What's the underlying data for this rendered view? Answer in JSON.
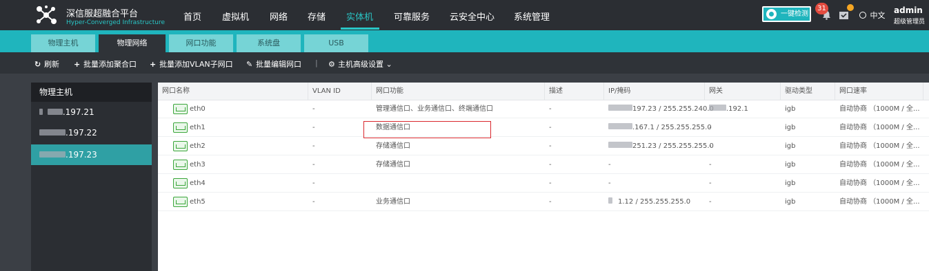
{
  "brand": {
    "title": "深信服超融合平台",
    "subtitle": "Hyper-Converged Infrastructure"
  },
  "nav": [
    "首页",
    "虚拟机",
    "网络",
    "存储",
    "实体机",
    "可靠服务",
    "云安全中心",
    "系统管理"
  ],
  "nav_active": "实体机",
  "header": {
    "onekey_label": "一键检测",
    "alert_count": "31",
    "lang_label": "中文",
    "user_name": "admin",
    "user_role": "超级管理员"
  },
  "tabs": [
    "物理主机",
    "物理网络",
    "网口功能",
    "系统盘",
    "USB"
  ],
  "tab_active": "物理网络",
  "toolbar": {
    "refresh": "刷新",
    "add_agg": "批量添加聚合口",
    "add_vlan": "批量添加VLAN子网口",
    "edit": "批量编辑网口",
    "sep": "|",
    "advanced": "主机高级设置"
  },
  "sidebar": {
    "title": "物理主机",
    "hosts": [
      ".197.21",
      ".197.22",
      ".197.23"
    ],
    "active_index": 2
  },
  "table": {
    "columns": [
      "网口名称",
      "VLAN ID",
      "网口功能",
      "描述",
      "IP/掩码",
      "网关",
      "驱动类型",
      "网口速率"
    ],
    "rows": [
      {
        "name": "eth0",
        "vlan": "-",
        "function": "管理通信口、业务通信口、终端通信口",
        "desc": "-",
        "ip": "197.23 / 255.255.240.0",
        "gateway": ".192.1",
        "driver": "igb",
        "speed": "自动协商 （1000M / 全..."
      },
      {
        "name": "eth1",
        "vlan": "-",
        "function": "数据通信口",
        "desc": "-",
        "ip": ".167.1 / 255.255.255.0",
        "gateway": "-",
        "driver": "igb",
        "speed": "自动协商 （1000M / 全..."
      },
      {
        "name": "eth2",
        "vlan": "-",
        "function": "存储通信口",
        "desc": "-",
        "ip": "251.23 / 255.255.255.0",
        "gateway": "-",
        "driver": "igb",
        "speed": "自动协商 （1000M / 全..."
      },
      {
        "name": "eth3",
        "vlan": "-",
        "function": "存储通信口",
        "desc": "-",
        "ip": "-",
        "gateway": "-",
        "driver": "igb",
        "speed": "自动协商 （1000M / 全..."
      },
      {
        "name": "eth4",
        "vlan": "-",
        "function": "",
        "desc": "-",
        "ip": "-",
        "gateway": "-",
        "driver": "igb",
        "speed": "自动协商 （1000M / 全..."
      },
      {
        "name": "eth5",
        "vlan": "-",
        "function": "业务通信口",
        "desc": "-",
        "ip": "1.12 / 255.255.255.0",
        "gateway": "-",
        "driver": "igb",
        "speed": "自动协商 （1000M / 全..."
      }
    ]
  },
  "colors": {
    "accent": "#1fb5bd",
    "topbar": "#2b2e33",
    "highlight": "#d9262c"
  }
}
